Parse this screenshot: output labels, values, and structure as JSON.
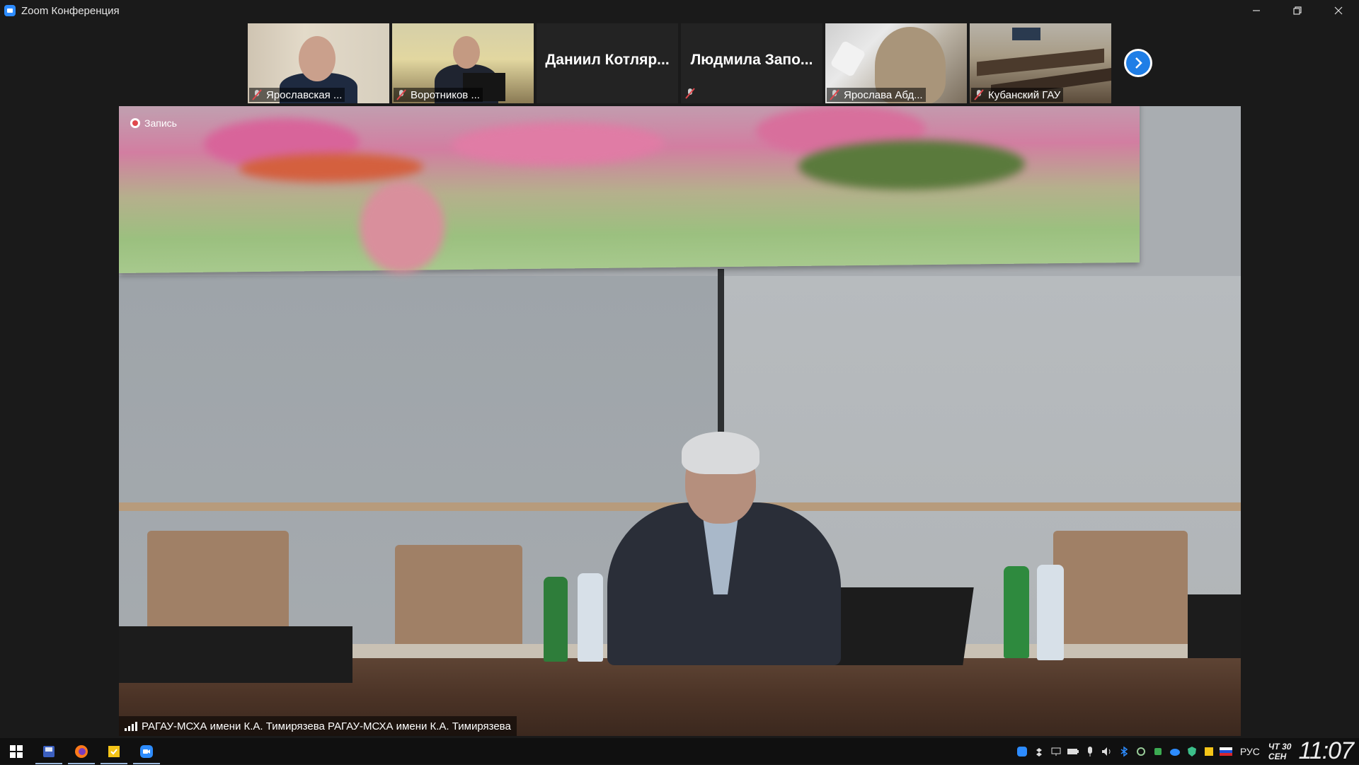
{
  "window": {
    "title": "Zoom Конференция",
    "accent": "#2d8cff"
  },
  "participants": [
    {
      "name": "Ярославская ...",
      "muted": true,
      "video": true
    },
    {
      "name": "Воротников ...",
      "muted": true,
      "video": true
    },
    {
      "name": "Даниил Котляр...",
      "muted": false,
      "video": false
    },
    {
      "name": "Людмила Запо...",
      "muted": true,
      "video": false
    },
    {
      "name": "Ярослава Абд...",
      "muted": true,
      "video": true
    },
    {
      "name": "Кубанский ГАУ",
      "muted": true,
      "video": true
    }
  ],
  "main": {
    "recording_label": "Запись",
    "speaker_label": "РАГАУ-МСХА имени К.А. Тимирязева РАГАУ-МСХА имени К.А. Тимирязева"
  },
  "taskbar": {
    "apps": [
      "windows-start",
      "file-manager",
      "firefox",
      "sticky-notes",
      "zoom"
    ],
    "language": "РУС",
    "date_day": "ЧТ  30",
    "date_month": "СЕН",
    "time": "11:07"
  }
}
